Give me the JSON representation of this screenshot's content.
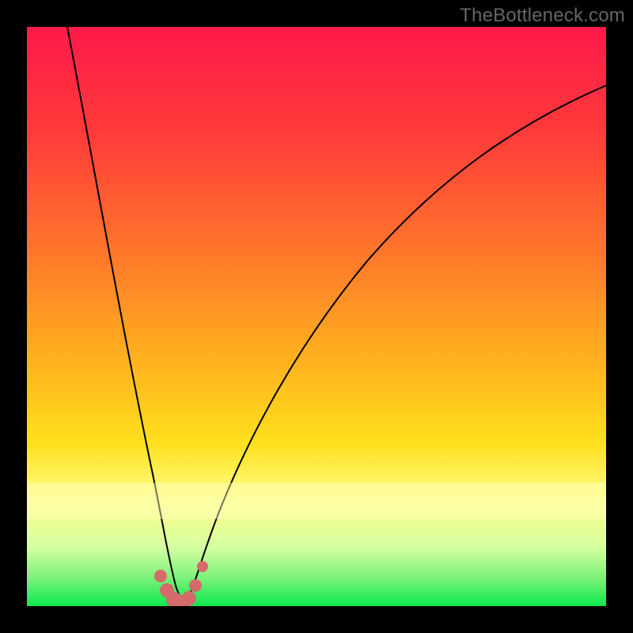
{
  "watermark": "TheBottleneck.com",
  "colors": {
    "black": "#000000",
    "gradient_top": "#ff1a4a",
    "gradient_mid1": "#ff6a2a",
    "gradient_mid2": "#ffd21e",
    "gradient_mid3": "#ffff8a",
    "gradient_bottom": "#0ee84e",
    "curve": "#000000",
    "dots": "#d46a6a"
  },
  "chart_data": {
    "type": "line",
    "title": "",
    "xlabel": "",
    "ylabel": "",
    "xlim": [
      0,
      100
    ],
    "ylim": [
      0,
      100
    ],
    "series": [
      {
        "name": "bottleneck-curve",
        "x": [
          7,
          10,
          14,
          18,
          22,
          24,
          26,
          28,
          29,
          30,
          32,
          36,
          42,
          50,
          60,
          72,
          86,
          100
        ],
        "y": [
          100,
          72,
          44,
          22,
          8,
          2,
          0,
          0,
          2,
          6,
          12,
          24,
          38,
          52,
          64,
          73,
          80,
          85
        ]
      }
    ],
    "highlight_points": {
      "name": "optimal-range-dots",
      "color": "#d46a6a",
      "x": [
        23.5,
        24.5,
        25.5,
        26.5,
        27.5,
        28.5,
        29.5
      ],
      "y": [
        4,
        1.5,
        0.2,
        0.2,
        0.8,
        2.5,
        6
      ]
    },
    "gradient_stops": [
      {
        "offset": 0,
        "color": "#ff1a4a"
      },
      {
        "offset": 40,
        "color": "#ff7a2a"
      },
      {
        "offset": 68,
        "color": "#ffd21e"
      },
      {
        "offset": 84,
        "color": "#ffff8a"
      },
      {
        "offset": 100,
        "color": "#0ee84e"
      }
    ]
  }
}
